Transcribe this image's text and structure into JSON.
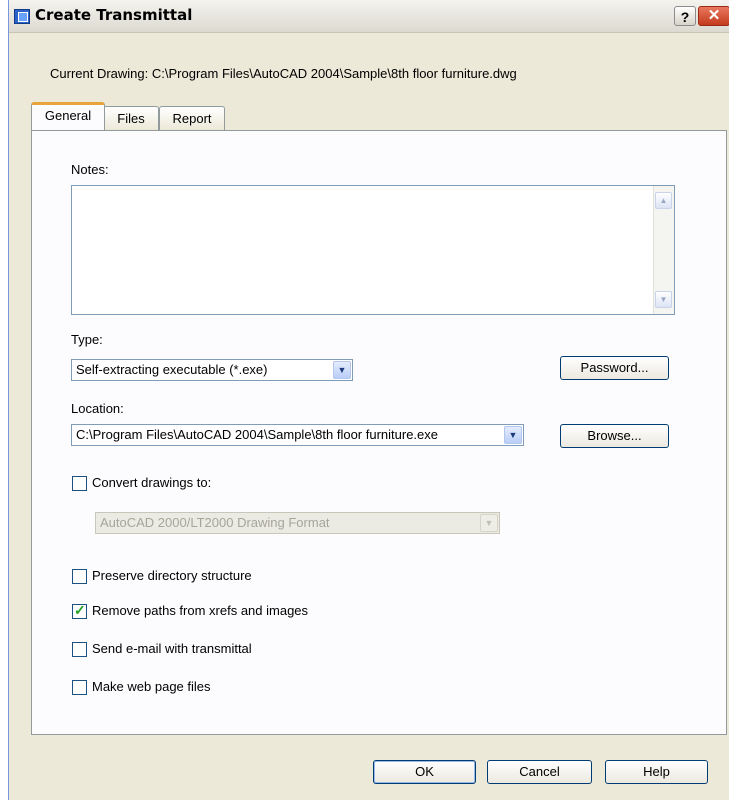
{
  "window": {
    "title": "Create Transmittal",
    "help_label": "?",
    "close_label": "✕",
    "icon": "transmittal-icon"
  },
  "current_drawing": "Current Drawing: C:\\Program Files\\AutoCAD 2004\\Sample\\8th floor furniture.dwg",
  "tabs": [
    {
      "label": "General",
      "active": true
    },
    {
      "label": "Files",
      "active": false
    },
    {
      "label": "Report",
      "active": false
    }
  ],
  "general": {
    "notes_label": "Notes:",
    "notes_value": "",
    "type_label": "Type:",
    "type_value": "Self-extracting executable (*.exe)",
    "password_label": "Password...",
    "location_label": "Location:",
    "location_value": "C:\\Program Files\\AutoCAD 2004\\Sample\\8th floor furniture.exe",
    "browse_label": "Browse...",
    "convert_label": "Convert drawings to:",
    "convert_checked": false,
    "format_value": "AutoCAD 2000/LT2000 Drawing Format",
    "preserve_label": "Preserve directory structure",
    "preserve_checked": false,
    "remove_paths_label": "Remove paths from xrefs and images",
    "remove_paths_checked": true,
    "send_email_label": "Send e-mail with transmittal",
    "send_email_checked": false,
    "web_page_label": "Make web page files",
    "web_page_checked": false
  },
  "buttons": {
    "ok": "OK",
    "cancel": "Cancel",
    "help": "Help"
  },
  "colors": {
    "dialog_bg": "#ece9d8",
    "panel_bg": "#fcfcfe",
    "active_tab_accent": "#e8a33d",
    "checkmark": "#21a121",
    "close_button": "#c43a1c"
  }
}
